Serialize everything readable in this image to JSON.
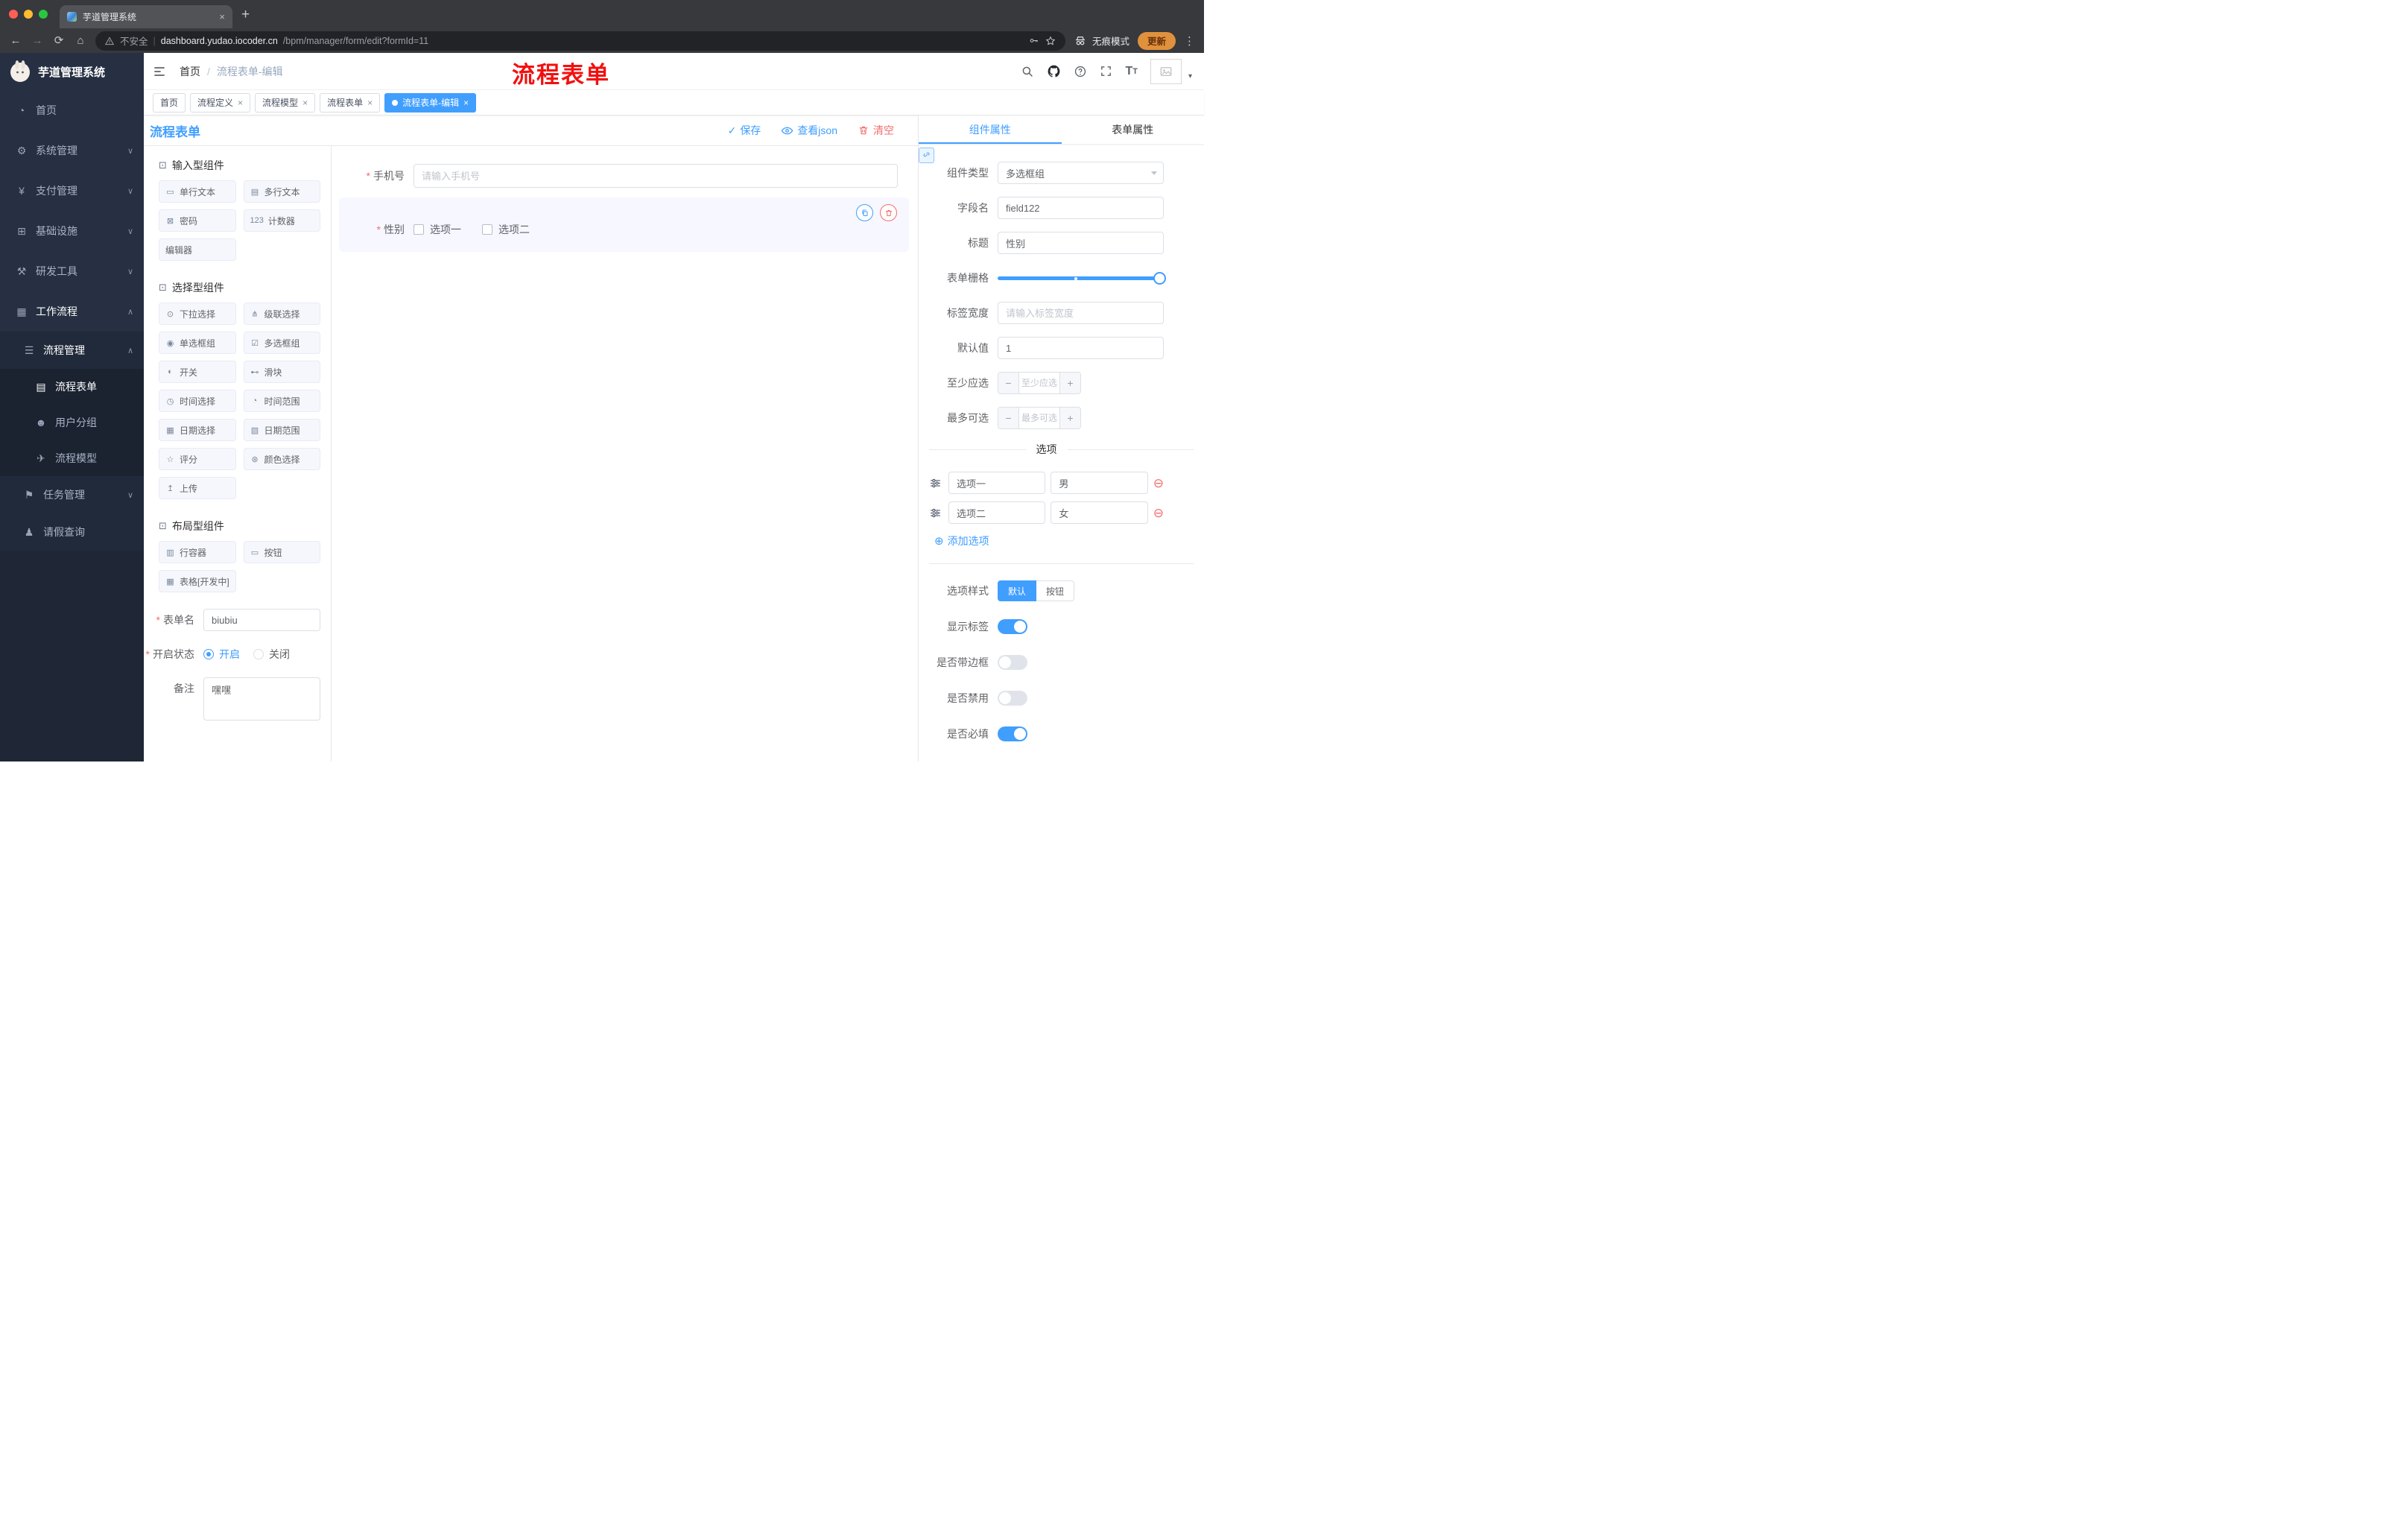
{
  "colors": {
    "accent": "#409eff",
    "danger": "#f56c6c",
    "sidebar": "#1f2635",
    "annotation": "#f40f0f",
    "tag_active": "#409eff"
  },
  "browser": {
    "tab_title": "芋道管理系统",
    "tab_close_glyph": "×",
    "new_tab_glyph": "+",
    "nav": {
      "back": "←",
      "forward": "→",
      "reload": "⟳",
      "home": "⌂"
    },
    "security_label": "不安全",
    "url_host": "dashboard.yudao.iocoder.cn",
    "url_path": "/bpm/manager/form/edit?formId=11",
    "incognito_label": "无痕模式",
    "update_label": "更新",
    "kebab_glyph": "⋮"
  },
  "sidebar": {
    "brand": "芋道管理系统",
    "items": [
      {
        "icon": "◔",
        "label": "首页",
        "chev": ""
      },
      {
        "icon": "⚙",
        "label": "系统管理",
        "chev": "∨"
      },
      {
        "icon": "¥",
        "label": "支付管理",
        "chev": "∨"
      },
      {
        "icon": "⊞",
        "label": "基础设施",
        "chev": "∨"
      },
      {
        "icon": "⚒",
        "label": "研发工具",
        "chev": "∨"
      },
      {
        "icon": "▦",
        "label": "工作流程",
        "chev": "∧"
      },
      {
        "icon": "☰",
        "label": "流程管理",
        "chev": "∧"
      },
      {
        "icon": "▤",
        "label": "流程表单",
        "chev": ""
      },
      {
        "icon": "☻",
        "label": "用户分组",
        "chev": ""
      },
      {
        "icon": "✈",
        "label": "流程模型",
        "chev": ""
      },
      {
        "icon": "⚑",
        "label": "任务管理",
        "chev": "∨"
      },
      {
        "icon": "♟",
        "label": "请假查询",
        "chev": ""
      }
    ]
  },
  "header": {
    "breadcrumb_home": "首页",
    "breadcrumb_sep": "/",
    "breadcrumb_current": "流程表单-编辑",
    "annotation": "流程表单",
    "tt_big": "T",
    "tt_small": "T",
    "caret_glyph": "▾"
  },
  "tags": {
    "close_glyph": "×",
    "items": [
      {
        "label": "首页"
      },
      {
        "label": "流程定义"
      },
      {
        "label": "流程模型"
      },
      {
        "label": "流程表单"
      },
      {
        "label": "流程表单-编辑"
      }
    ]
  },
  "editor": {
    "title": "流程表单",
    "save_label": "保存",
    "save_check_glyph": "✓",
    "view_json_label": "查看json",
    "clear_label": "清空"
  },
  "palette": {
    "groups": [
      {
        "icon": "⊡",
        "title": "输入型组件",
        "items": [
          {
            "icon": "▭",
            "label": "单行文本"
          },
          {
            "icon": "▤",
            "label": "多行文本"
          },
          {
            "icon": "⊠",
            "label": "密码"
          },
          {
            "icon": "123",
            "label": "计数器"
          },
          {
            "icon": "",
            "label": "编辑器"
          }
        ]
      },
      {
        "icon": "⊡",
        "title": "选择型组件",
        "items": [
          {
            "icon": "⊙",
            "label": "下拉选择"
          },
          {
            "icon": "⋔",
            "label": "级联选择"
          },
          {
            "icon": "◉",
            "label": "单选框组"
          },
          {
            "icon": "☑",
            "label": "多选框组"
          },
          {
            "icon": "◐",
            "label": "开关"
          },
          {
            "icon": "⊷",
            "label": "滑块"
          },
          {
            "icon": "◷",
            "label": "时间选择"
          },
          {
            "icon": "◔",
            "label": "时间范围"
          },
          {
            "icon": "▦",
            "label": "日期选择"
          },
          {
            "icon": "▧",
            "label": "日期范围"
          },
          {
            "icon": "☆",
            "label": "评分"
          },
          {
            "icon": "⊛",
            "label": "颜色选择"
          },
          {
            "icon": "↥",
            "label": "上传"
          }
        ]
      },
      {
        "icon": "⊡",
        "title": "布局型组件",
        "items": [
          {
            "icon": "▥",
            "label": "行容器"
          },
          {
            "icon": "▭",
            "label": "按钮"
          },
          {
            "icon": "▦",
            "label": "表格[开发中]"
          }
        ]
      }
    ],
    "form_name_label": "表单名",
    "form_name_value": "biubiu",
    "status_label": "开启状态",
    "status_on": "开启",
    "status_off": "关闭",
    "remark_label": "备注",
    "remark_value": "嘿嘿"
  },
  "canvas": {
    "phone_label": "手机号",
    "phone_placeholder": "请输入手机号",
    "gender_label": "性别",
    "gender_options": [
      "选项一",
      "选项二"
    ]
  },
  "props": {
    "tab_component": "组件属性",
    "tab_form": "表单属性",
    "type_label": "组件类型",
    "type_value": "多选框组",
    "field_label": "字段名",
    "field_value": "field122",
    "title_label": "标题",
    "title_value": "性别",
    "grid_label": "表单栅格",
    "width_label": "标签宽度",
    "width_placeholder": "请输入标签宽度",
    "default_label": "默认值",
    "default_value": "1",
    "min_label": "至少应选",
    "min_placeholder": "至少应选",
    "max_label": "最多可选",
    "max_placeholder": "最多可选",
    "minus_glyph": "−",
    "plus_glyph": "+",
    "options_title": "选项",
    "options": [
      {
        "label": "选项一",
        "value": "男"
      },
      {
        "label": "选项二",
        "value": "女"
      }
    ],
    "remove_glyph": "⊖",
    "add_plus_glyph": "⊕",
    "add_option": "添加选项",
    "style_label": "选项样式",
    "style_default": "默认",
    "style_button": "按钮",
    "switch_show_label": "显示标签",
    "switch_border": "是否带边框",
    "switch_disabled": "是否禁用",
    "switch_required": "是否必填"
  }
}
